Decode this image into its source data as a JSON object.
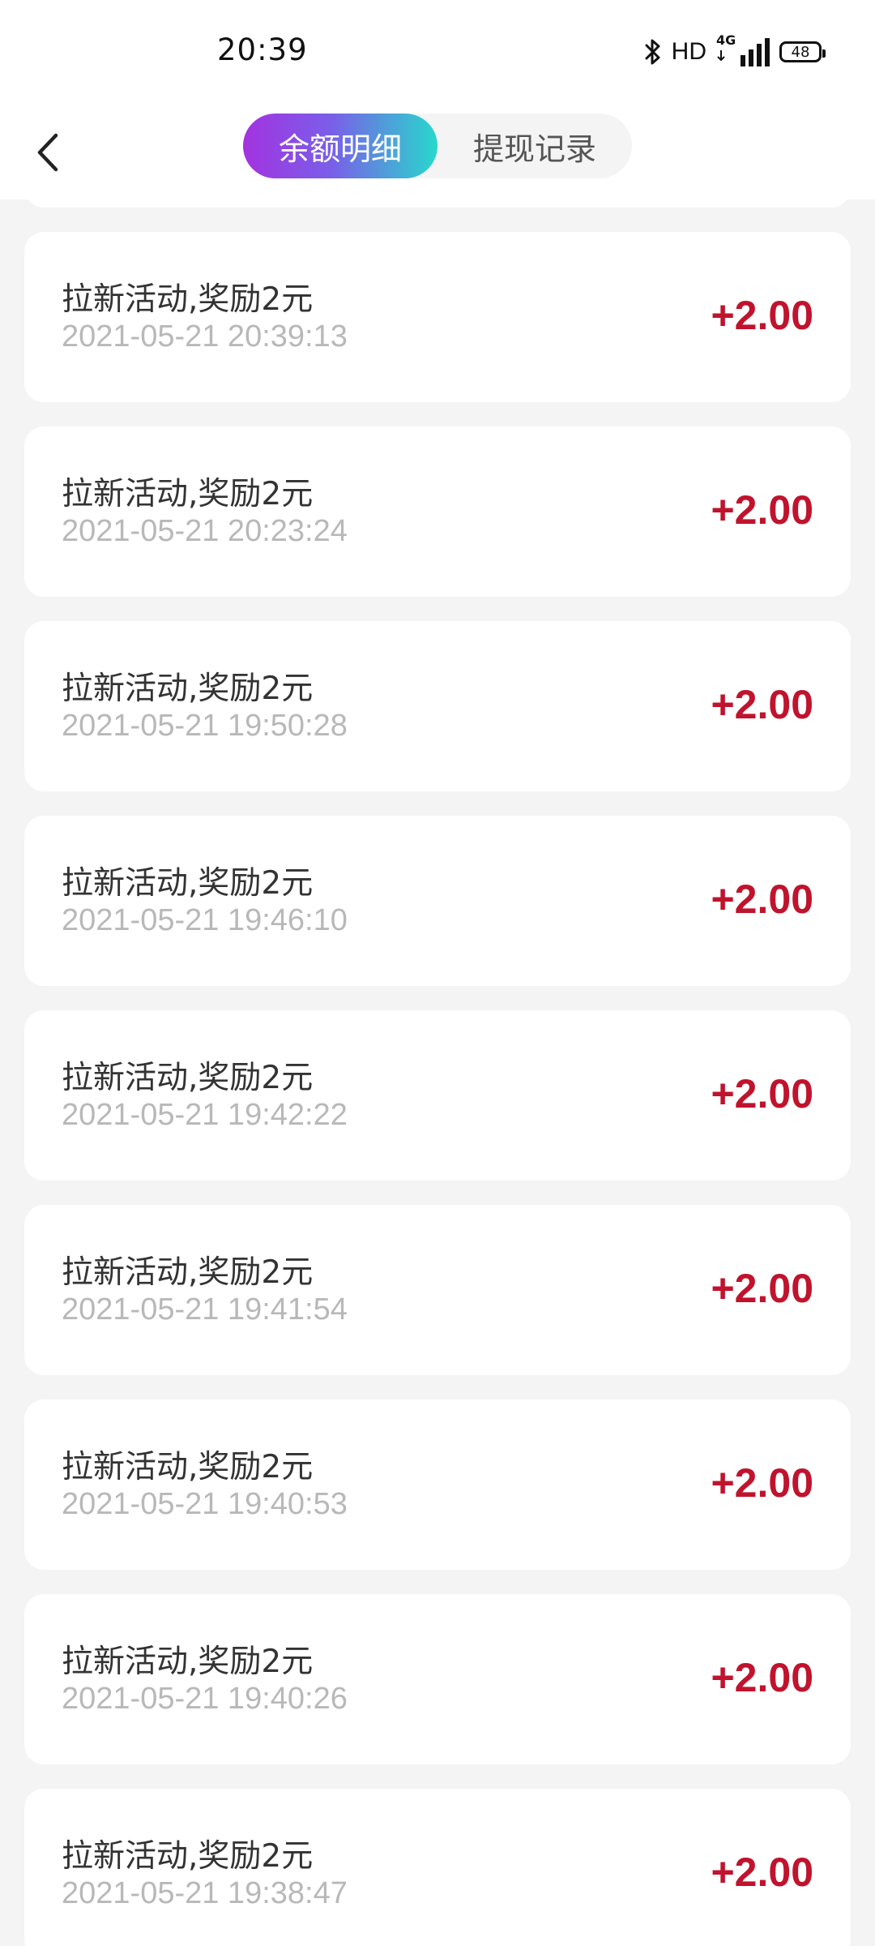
{
  "status_bar": {
    "time": "20:39",
    "network_label": "HD",
    "signal_label": "4G",
    "battery_level": "48",
    "icons": [
      "bluetooth-icon",
      "signal-icon",
      "battery-icon"
    ]
  },
  "nav": {
    "back_icon": "chevron-left-icon",
    "tabs": [
      {
        "label": "余额明细",
        "active": true
      },
      {
        "label": "提现记录",
        "active": false
      }
    ],
    "accent_gradient": [
      "#a333e0",
      "#27d8cc"
    ]
  },
  "records": [
    {
      "title": "拉新活动,奖励2元",
      "time": "2021-05-21 20:39:13",
      "amount": "+2.00"
    },
    {
      "title": "拉新活动,奖励2元",
      "time": "2021-05-21 20:23:24",
      "amount": "+2.00"
    },
    {
      "title": "拉新活动,奖励2元",
      "time": "2021-05-21 19:50:28",
      "amount": "+2.00"
    },
    {
      "title": "拉新活动,奖励2元",
      "time": "2021-05-21 19:46:10",
      "amount": "+2.00"
    },
    {
      "title": "拉新活动,奖励2元",
      "time": "2021-05-21 19:42:22",
      "amount": "+2.00"
    },
    {
      "title": "拉新活动,奖励2元",
      "time": "2021-05-21 19:41:54",
      "amount": "+2.00"
    },
    {
      "title": "拉新活动,奖励2元",
      "time": "2021-05-21 19:40:53",
      "amount": "+2.00"
    },
    {
      "title": "拉新活动,奖励2元",
      "time": "2021-05-21 19:40:26",
      "amount": "+2.00"
    },
    {
      "title": "拉新活动,奖励2元",
      "time": "2021-05-21 19:38:47",
      "amount": "+2.00"
    }
  ],
  "colors": {
    "amount": "#c0132d",
    "background": "#f4f4f4",
    "card": "#ffffff",
    "time_text": "#b8b8b8"
  }
}
